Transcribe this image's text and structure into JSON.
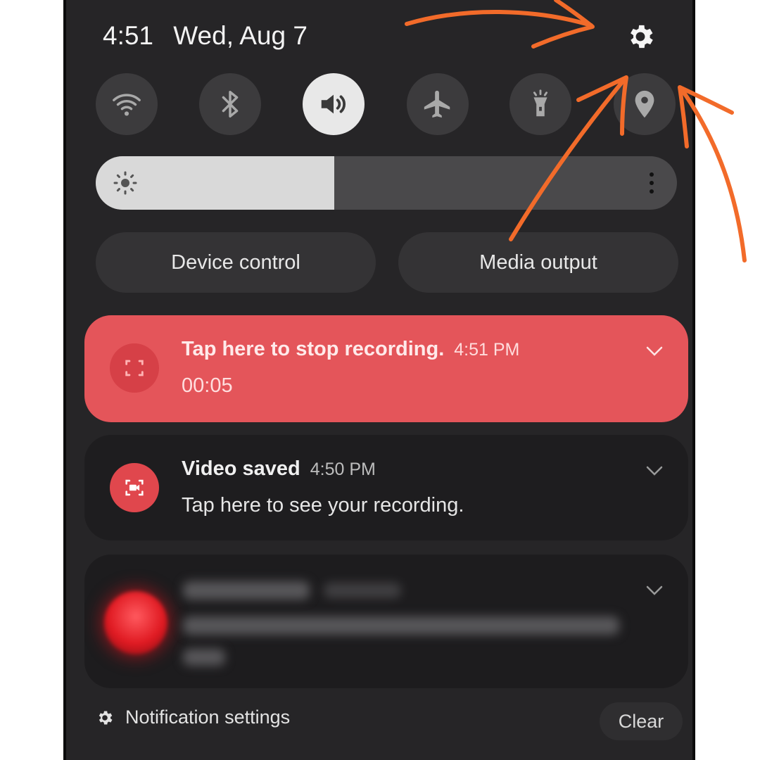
{
  "status_bar": {
    "time": "4:51",
    "date": "Wed, Aug 7",
    "settings_icon": "gear-icon"
  },
  "quick_settings": [
    {
      "name": "wifi",
      "icon": "wifi-icon",
      "active": false
    },
    {
      "name": "bluetooth",
      "icon": "bluetooth-icon",
      "active": false
    },
    {
      "name": "sound",
      "icon": "speaker-icon",
      "active": true
    },
    {
      "name": "airplane",
      "icon": "airplane-icon",
      "active": false
    },
    {
      "name": "flashlight",
      "icon": "flashlight-icon",
      "active": false
    },
    {
      "name": "location",
      "icon": "location-pin-icon",
      "active": false
    }
  ],
  "brightness": {
    "level_fraction": 0.41,
    "icon": "sun-icon",
    "more_icon": "more-vertical-icon"
  },
  "buttons": {
    "device_control": "Device control",
    "media_output": "Media output"
  },
  "notifications": [
    {
      "title": "Tap here to stop recording.",
      "time": "4:51 PM",
      "body": "00:05",
      "icon": "screen-record-icon",
      "color": "#e4555a"
    },
    {
      "title": "Video saved",
      "time": "4:50 PM",
      "body": "Tap here to see your recording.",
      "icon": "video-saved-icon",
      "color": "#1e1d1f"
    },
    {
      "icon": "app-icon",
      "blurred": true
    }
  ],
  "footer": {
    "notification_settings": "Notification settings",
    "clear": "Clear"
  },
  "colors": {
    "panel": "#262527",
    "accent_arrow": "#f26b2a",
    "recording": "#e4555a"
  }
}
